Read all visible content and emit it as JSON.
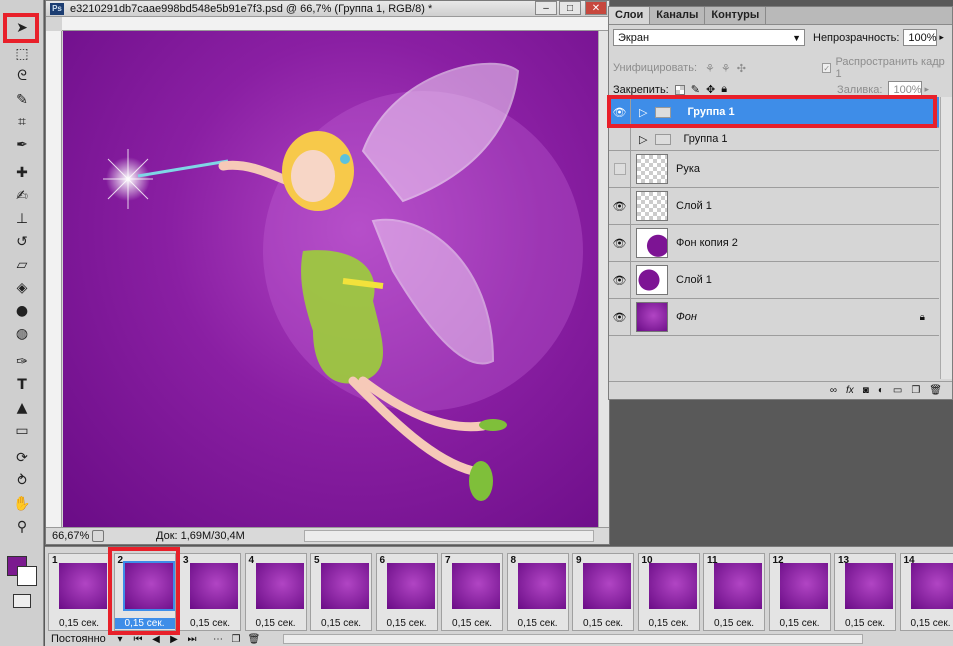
{
  "toolbox": {
    "tools": [
      "move-tool",
      "marquee-tool",
      "lasso-tool",
      "quick-select-tool",
      "crop-tool",
      "eyedropper-tool",
      "healing-tool",
      "brush-tool",
      "clone-stamp-tool",
      "history-brush-tool",
      "eraser-tool",
      "paint-bucket-tool",
      "blur-tool",
      "dodge-tool",
      "pen-tool",
      "type-tool",
      "path-select-tool",
      "rectangle-tool",
      "3d-rotate-tool",
      "3d-orbit-tool",
      "hand-tool",
      "zoom-tool"
    ],
    "foreground_color": "#7b1a8f",
    "background_color": "#ffffff"
  },
  "document": {
    "title": "e3210291db7caae998bd548e5b91e7f3.psd @ 66,7% (Группа 1, RGB/8) *",
    "zoom": "66,67%",
    "doc_info": "Док: 1,69M/30,4M"
  },
  "layers_panel": {
    "tabs": [
      "Слои",
      "Каналы",
      "Контуры"
    ],
    "blend_mode": "Экран",
    "opacity_label": "Непрозрачность:",
    "opacity_value": "100%",
    "unify_label": "Унифицировать:",
    "propagate_label": "Распространить кадр 1",
    "lock_label": "Закрепить:",
    "fill_label": "Заливка:",
    "fill_value": "100%",
    "layers": [
      {
        "name": "Группа 1",
        "type": "group",
        "visible": true,
        "selected": true
      },
      {
        "name": "Группа 1",
        "type": "group",
        "visible": false,
        "selected": false
      },
      {
        "name": "Рука",
        "type": "layer",
        "visible": false,
        "selected": false
      },
      {
        "name": "Слой 1",
        "type": "layer",
        "visible": true,
        "selected": false
      },
      {
        "name": "Фон копия 2",
        "type": "layer",
        "visible": true,
        "selected": false
      },
      {
        "name": "Слой 1",
        "type": "layer",
        "visible": true,
        "selected": false
      },
      {
        "name": "Фон",
        "type": "background",
        "visible": true,
        "selected": false,
        "locked": true
      }
    ]
  },
  "timeline": {
    "frames": [
      {
        "num": "1",
        "time": "0,15 сек."
      },
      {
        "num": "2",
        "time": "0,15 сек."
      },
      {
        "num": "3",
        "time": "0,15 сек."
      },
      {
        "num": "4",
        "time": "0,15 сек."
      },
      {
        "num": "5",
        "time": "0,15 сек."
      },
      {
        "num": "6",
        "time": "0,15 сек."
      },
      {
        "num": "7",
        "time": "0,15 сек."
      },
      {
        "num": "8",
        "time": "0,15 сек."
      },
      {
        "num": "9",
        "time": "0,15 сек."
      },
      {
        "num": "10",
        "time": "0,15 сек."
      },
      {
        "num": "11",
        "time": "0,15 сек."
      },
      {
        "num": "12",
        "time": "0,15 сек."
      },
      {
        "num": "13",
        "time": "0,15 сек."
      },
      {
        "num": "14",
        "time": "0,15 сек."
      }
    ],
    "selected_frame": "2",
    "loop": "Постоянно"
  },
  "colors": {
    "selection_blue": "#3e8de8",
    "highlight_red": "#e8202a",
    "canvas_purple": "#8a1fa3"
  }
}
